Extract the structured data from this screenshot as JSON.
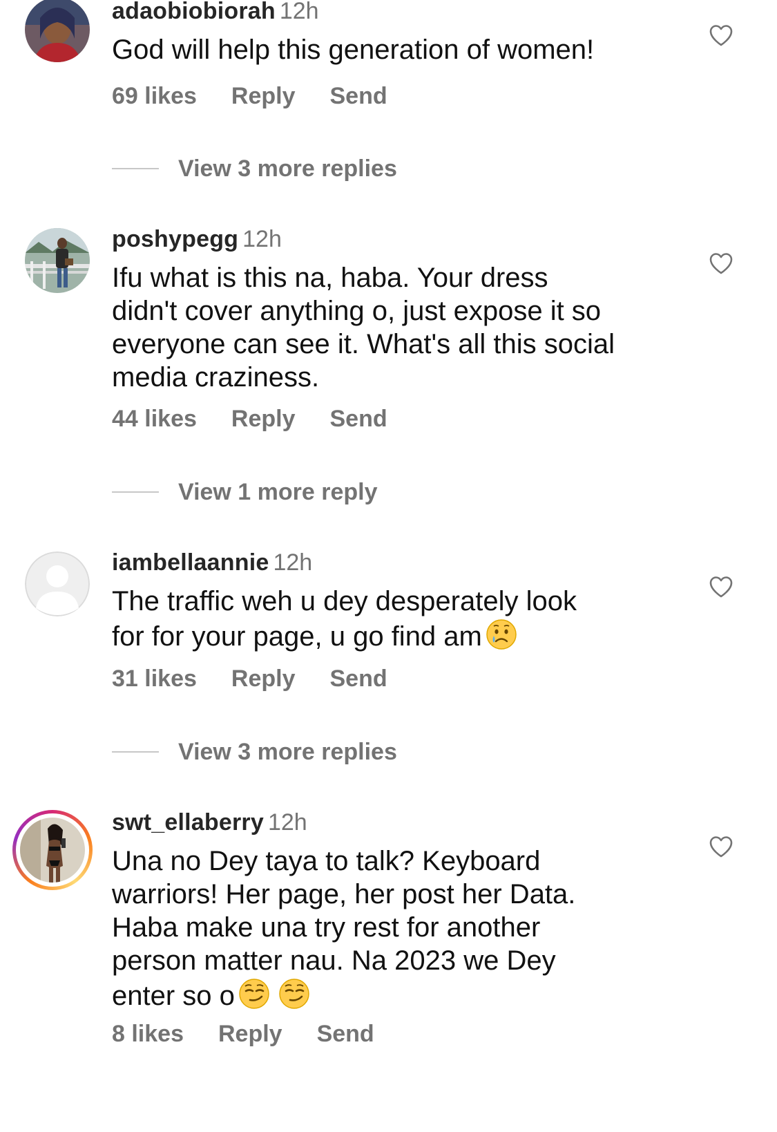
{
  "comments": [
    {
      "username": "adaobiobiorah",
      "time": "12h",
      "text": "God will help this generation of women!",
      "likes": "69 likes",
      "reply": "Reply",
      "send": "Send",
      "view_replies": "View 3 more replies"
    },
    {
      "username": "poshypegg",
      "time": "12h",
      "text": "Ifu what is this na, haba. Your dress\ndidn't cover anything o, just expose it so\neveryone can see it. What's all this social\nmedia craziness.",
      "likes": "44 likes",
      "reply": "Reply",
      "send": "Send",
      "view_replies": "View 1 more reply"
    },
    {
      "username": "iambellaannie",
      "time": "12h",
      "text": "The traffic weh u dey desperately look\nfor for your page, u go find am",
      "emoji": "crying-face-emoji",
      "likes": "31 likes",
      "reply": "Reply",
      "send": "Send",
      "view_replies": "View 3 more replies"
    },
    {
      "username": "swt_ellaberry",
      "time": "12h",
      "text": "Una no Dey taya to talk? Keyboard\nwarriors! Her page, her post her Data.\nHaba make una try rest for another\nperson matter nau. Na 2023 we Dey\nenter so o",
      "emoji": "smirking-face-emoji",
      "likes": "8 likes",
      "reply": "Reply",
      "send": "Send"
    }
  ],
  "colors": {
    "text": "#111111",
    "secondary": "#737373",
    "username": "#262626",
    "divider": "#c7c7c7",
    "story_ring": [
      "#d62976",
      "#fa7e1e",
      "#feda75",
      "#962fbf"
    ]
  }
}
